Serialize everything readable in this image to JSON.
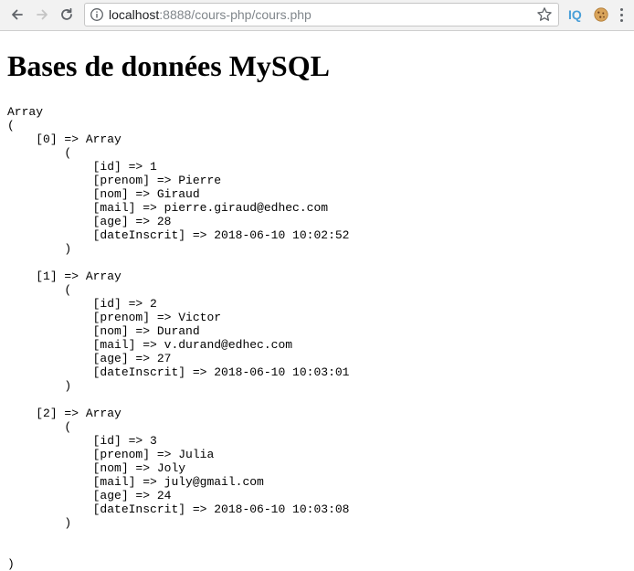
{
  "browser": {
    "url_host": "localhost",
    "url_path": ":8888/cours-php/cours.php",
    "ext_iq_label": "IQ"
  },
  "page": {
    "title": "Bases de données MySQL",
    "array_open": "Array",
    "paren_open": "(",
    "paren_close": ")",
    "records": [
      {
        "index_line": "[0] => Array",
        "open": "(",
        "fields": [
          "[id] => 1",
          "[prenom] => Pierre",
          "[nom] => Giraud",
          "[mail] => pierre.giraud@edhec.com",
          "[age] => 28",
          "[dateInscrit] => 2018-06-10 10:02:52"
        ],
        "close": ")"
      },
      {
        "index_line": "[1] => Array",
        "open": "(",
        "fields": [
          "[id] => 2",
          "[prenom] => Victor",
          "[nom] => Durand",
          "[mail] => v.durand@edhec.com",
          "[age] => 27",
          "[dateInscrit] => 2018-06-10 10:03:01"
        ],
        "close": ")"
      },
      {
        "index_line": "[2] => Array",
        "open": "(",
        "fields": [
          "[id] => 3",
          "[prenom] => Julia",
          "[nom] => Joly",
          "[mail] => july@gmail.com",
          "[age] => 24",
          "[dateInscrit] => 2018-06-10 10:03:08"
        ],
        "close": ")"
      }
    ]
  }
}
